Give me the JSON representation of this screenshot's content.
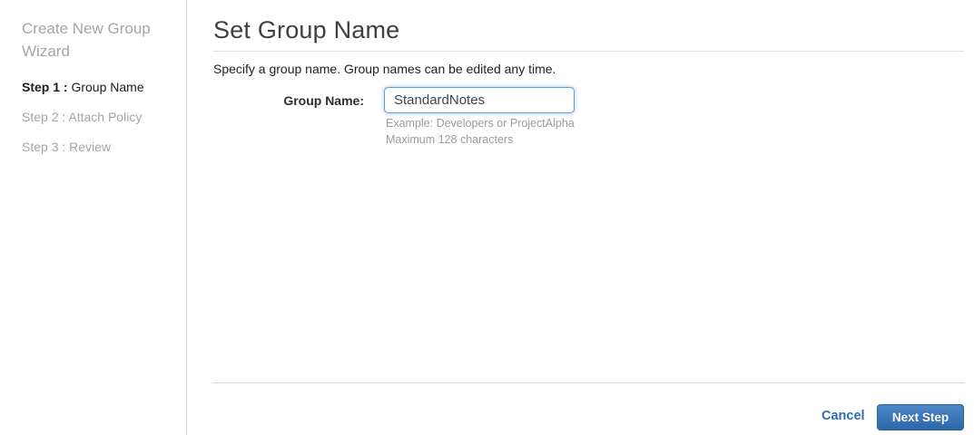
{
  "sidebar": {
    "title": "Create New Group Wizard",
    "steps": [
      {
        "prefix": "Step 1 :",
        "label": "Group Name"
      },
      {
        "prefix": "Step 2 :",
        "label": "Attach Policy"
      },
      {
        "prefix": "Step 3 :",
        "label": "Review"
      }
    ]
  },
  "main": {
    "title": "Set Group Name",
    "description": "Specify a group name. Group names can be edited any time.",
    "form": {
      "label": "Group Name:",
      "value": "StandardNotes",
      "hint_example": "Example: Developers or ProjectAlpha",
      "hint_max": "Maximum 128 characters"
    },
    "footer": {
      "cancel": "Cancel",
      "next": "Next Step"
    }
  },
  "colors": {
    "accent_blue": "#2a6db8",
    "button_gradient_top": "#4c87ca",
    "button_gradient_bottom": "#2c67aa",
    "input_focus_border": "#5b9fd9",
    "inactive_gray": "#a5a5a5",
    "divider_gray": "#d9d9d9"
  }
}
